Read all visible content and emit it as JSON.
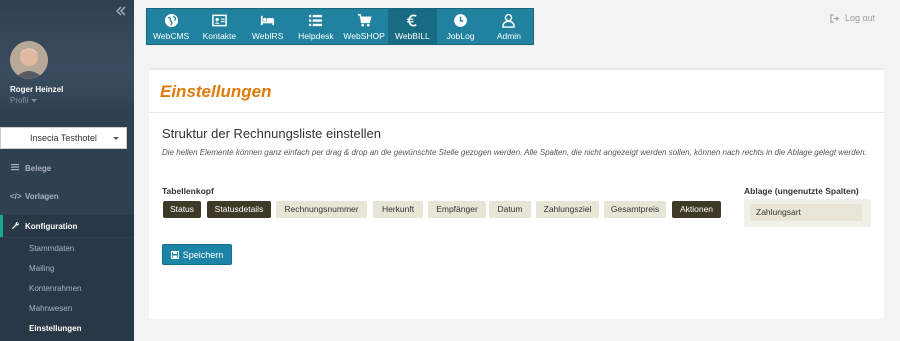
{
  "sidebar": {
    "profile_name": "Roger Heinzel",
    "profile_sub": "Profil",
    "hotel": "Insecia Testhotel",
    "nav": [
      {
        "label": "Belege",
        "icon": "list-icon"
      },
      {
        "label": "Vorlagen",
        "icon": "code-icon"
      },
      {
        "label": "Konfiguration",
        "icon": "wrench-icon"
      }
    ],
    "submenu": [
      "Stammdaten",
      "Mailing",
      "Kontenrahmen",
      "Mahnwesen",
      "Einstellungen"
    ]
  },
  "topnav": {
    "tabs": [
      {
        "label": "WebCMS",
        "icon": "globe-icon"
      },
      {
        "label": "Kontakte",
        "icon": "contact-card-icon"
      },
      {
        "label": "WebIRS",
        "icon": "bed-icon"
      },
      {
        "label": "Helpdesk",
        "icon": "list-icon"
      },
      {
        "label": "WebSHOP",
        "icon": "cart-icon"
      },
      {
        "label": "WebBILL",
        "icon": "euro-icon"
      },
      {
        "label": "JobLog",
        "icon": "clock-icon"
      },
      {
        "label": "Admin",
        "icon": "user-icon"
      }
    ],
    "active": "WebBILL"
  },
  "logout": "Log out",
  "page": {
    "title": "Einstellungen",
    "section_title": "Struktur der Rechnungsliste einstellen",
    "description": "Die hellen Elemente können ganz einfach per drag & drop an die gewünschte Stelle gezogen werden. Alle Spalten, die nicht angezeigt werden sollen, können nach rechts in die Ablage gelegt werden.",
    "header_label": "Tabellenkopf",
    "ablage_label": "Ablage (ungenutzte Spalten)",
    "columns": [
      {
        "label": "Status",
        "style": "dark"
      },
      {
        "label": "Statusdetails",
        "style": "dark"
      },
      {
        "label": "Rechnungsnummer",
        "style": "light"
      },
      {
        "label": "Herkunft",
        "style": "light"
      },
      {
        "label": "Empfänger",
        "style": "light"
      },
      {
        "label": "Datum",
        "style": "light"
      },
      {
        "label": "Zahlungsziel",
        "style": "light"
      },
      {
        "label": "Gesamtpreis",
        "style": "light"
      },
      {
        "label": "Aktionen",
        "style": "dark"
      }
    ],
    "ablage_items": [
      "Zahlungsart"
    ],
    "save_label": "Speichern"
  },
  "colors": {
    "sidebar": "#2f4050",
    "topnav": "#20829f",
    "accent_orange": "#e07a0a",
    "chip_dark": "#3f3a28",
    "chip_light": "#e7e6d6"
  }
}
